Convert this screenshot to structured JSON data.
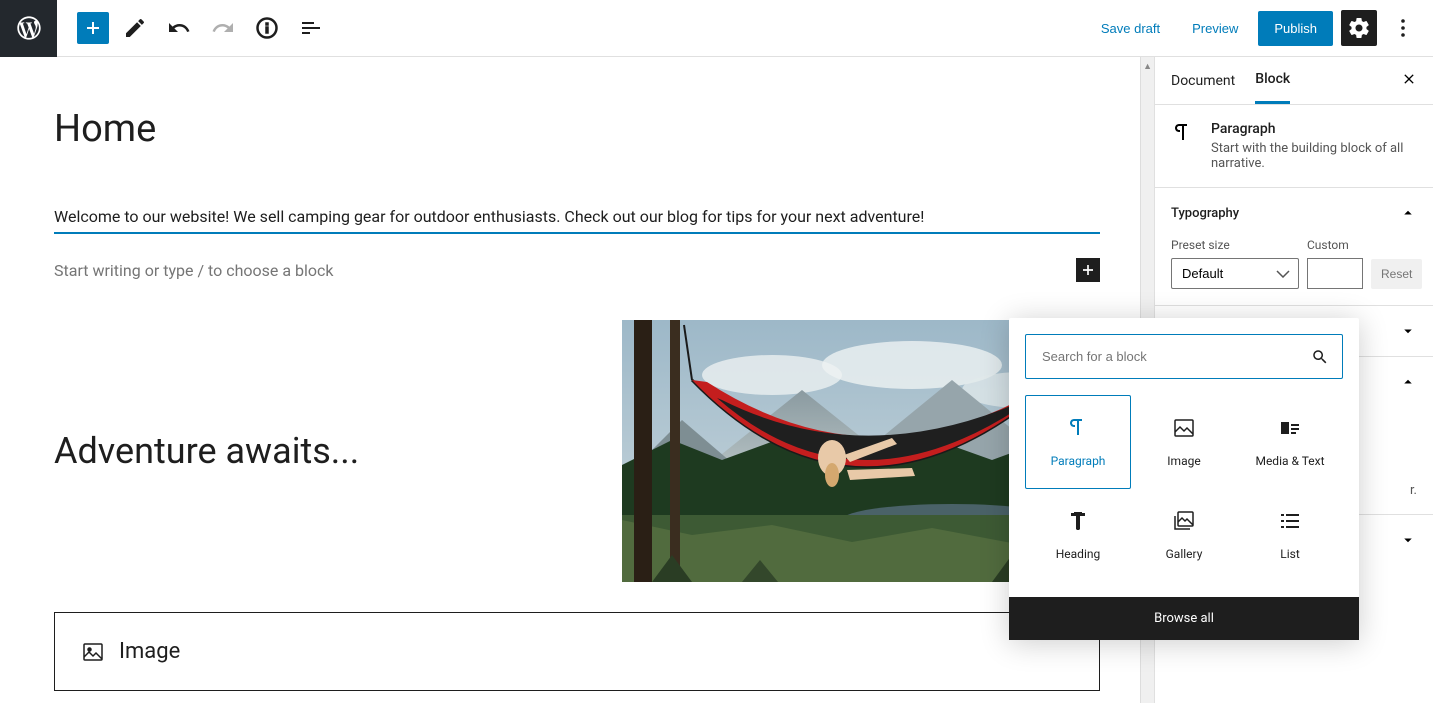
{
  "toolbar": {
    "save_draft": "Save draft",
    "preview": "Preview",
    "publish": "Publish"
  },
  "editor": {
    "title": "Home",
    "paragraph": "Welcome to our website! We sell camping gear for outdoor enthusiasts. Check out our blog for tips for your next adventure!",
    "placeholder": "Start writing or type / to choose a block",
    "heading": "Adventure awaits...",
    "image_label": "Image"
  },
  "sidebar": {
    "tabs": {
      "document": "Document",
      "block": "Block"
    },
    "block_name": "Paragraph",
    "block_desc": "Start with the building block of all narrative.",
    "panels": {
      "typography": "Typography",
      "preset_label": "Preset size",
      "preset_value": "Default",
      "custom_label": "Custom",
      "reset": "Reset"
    },
    "partial": "r."
  },
  "popover": {
    "search_placeholder": "Search for a block",
    "items": [
      "Paragraph",
      "Image",
      "Media & Text",
      "Heading",
      "Gallery",
      "List"
    ],
    "browse": "Browse all"
  }
}
